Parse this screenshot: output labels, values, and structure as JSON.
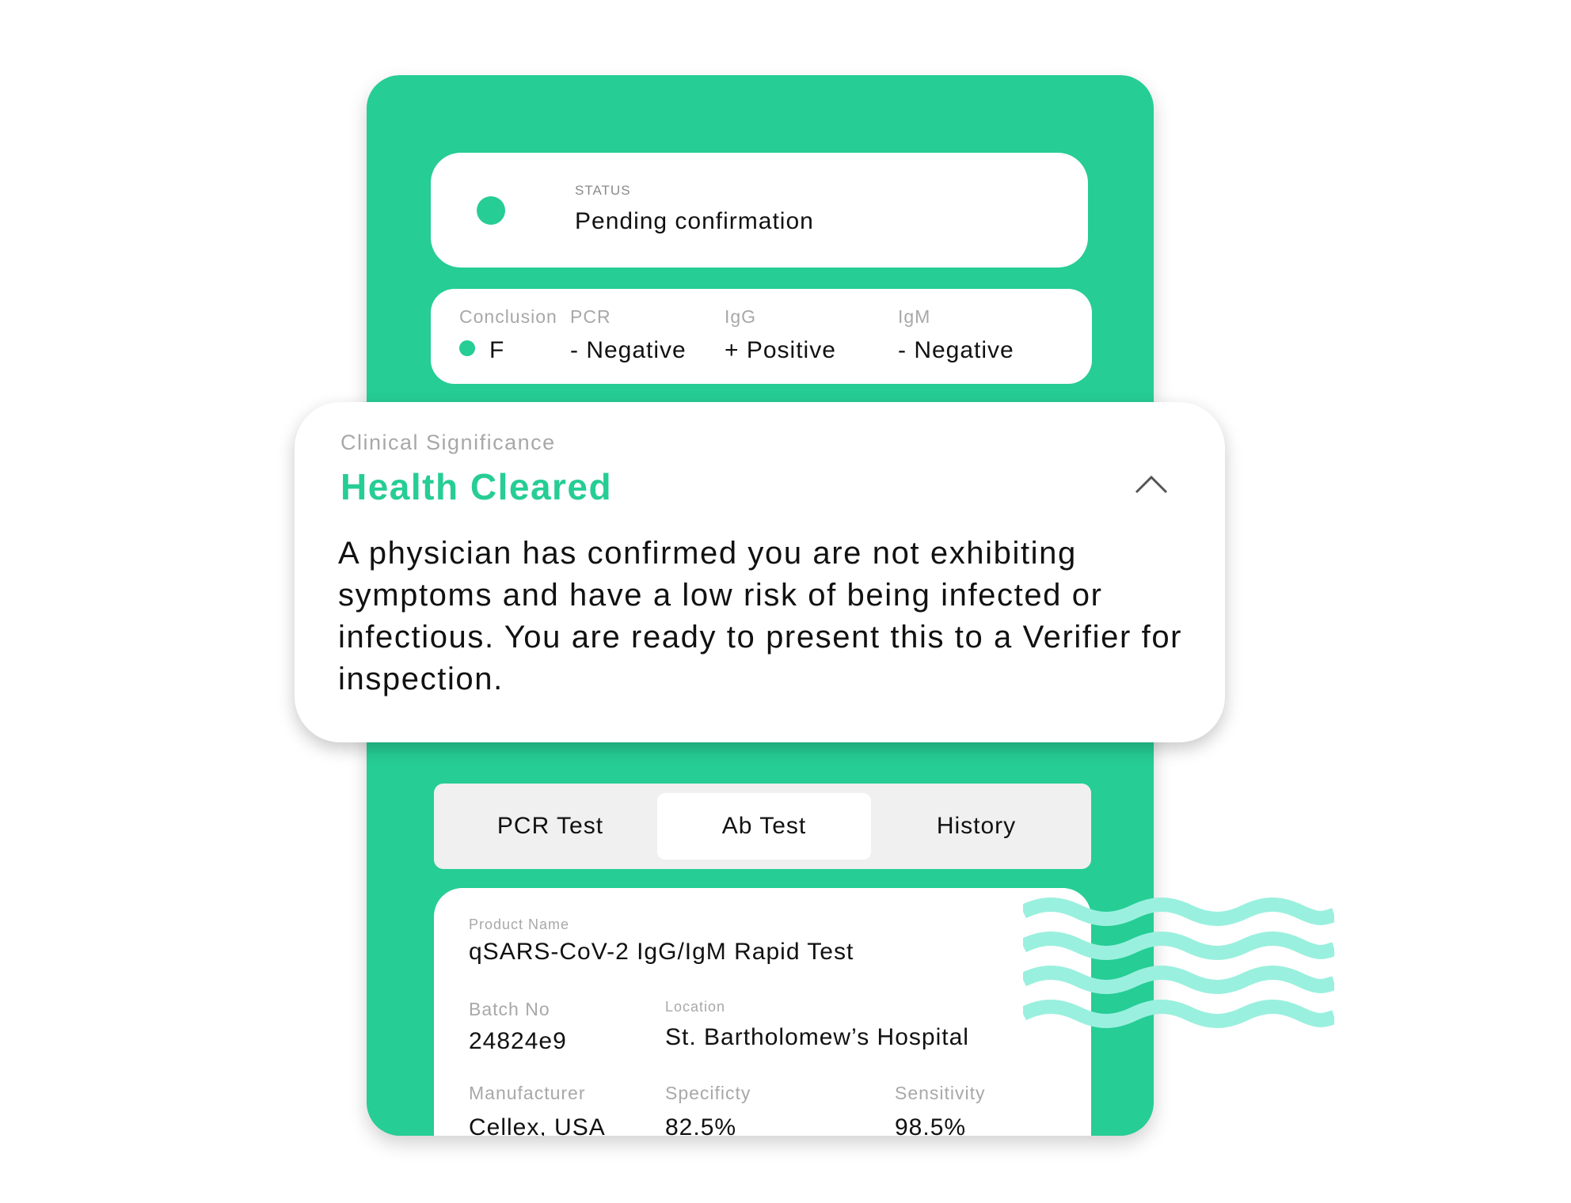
{
  "status": {
    "label": "STATUS",
    "value": "Pending confirmation"
  },
  "results": {
    "conclusion": {
      "label": "Conclusion",
      "value": "F"
    },
    "pcr": {
      "label": "PCR",
      "value": "- Negative"
    },
    "igg": {
      "label": "IgG",
      "value": "+ Positive"
    },
    "igm": {
      "label": "IgM",
      "value": "- Negative"
    }
  },
  "clinical": {
    "label": "Clinical Significance",
    "title": "Health Cleared",
    "body": "A physician has confirmed you are not exhibiting symptoms and have a low risk of being infected or infectious. You are ready to present this to a Verifier for inspection.",
    "toggle_icon": "chevron-up-icon"
  },
  "tabs": [
    {
      "label": "PCR Test",
      "active": false
    },
    {
      "label": "Ab Test",
      "active": true
    },
    {
      "label": "History",
      "active": false
    }
  ],
  "product": {
    "name_label": "Product Name",
    "name_value": "qSARS-CoV-2 IgG/IgM Rapid Test",
    "batch_label": "Batch No",
    "batch_value": "24824e9",
    "location_label": "Location",
    "location_value": "St. Bartholomew’s Hospital",
    "manufacturer_label": "Manufacturer",
    "manufacturer_value": "Cellex, USA",
    "specificity_label": "Specificty",
    "specificity_value": "82.5%",
    "sensitivity_label": "Sensitivity",
    "sensitivity_value": "98.5%"
  },
  "colors": {
    "brand_green": "#26cd95",
    "wave": "#9af0de",
    "tab_bg": "#f0f0f0"
  }
}
